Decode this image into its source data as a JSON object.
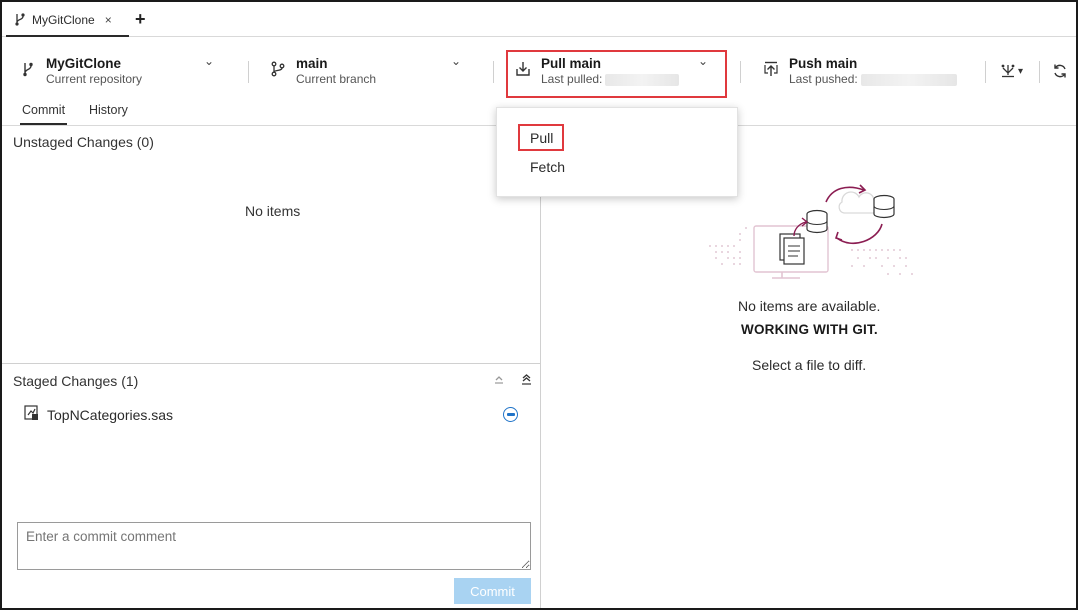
{
  "tab": {
    "title": "MyGitClone",
    "close": "×",
    "add": "+"
  },
  "toolbar": {
    "repo": {
      "title": "MyGitClone",
      "subtitle": "Current repository"
    },
    "branch": {
      "title": "main",
      "subtitle": "Current branch"
    },
    "pull": {
      "title": "Pull main",
      "subtitle": "Last pulled:"
    },
    "push": {
      "title": "Push main",
      "subtitle": "Last pushed:"
    },
    "chevron": "⌄",
    "more_caret": "▾"
  },
  "subtabs": [
    "Commit",
    "History"
  ],
  "unstaged": {
    "header": "Unstaged Changes (0)",
    "empty": "No items"
  },
  "staged": {
    "header": "Staged Changes (1)",
    "files": [
      "TopNCategories.sas"
    ]
  },
  "commit": {
    "placeholder": "Enter a commit comment",
    "button": "Commit"
  },
  "dropdown": {
    "items": [
      "Pull",
      "Fetch"
    ]
  },
  "empty_state": {
    "line1": "No items are available.",
    "line2": "WORKING WITH GIT.",
    "line3": "Select a file to diff."
  },
  "colors": {
    "accent": "#1f73c8",
    "highlight": "#e0393e",
    "illustration": "#8b1d52"
  }
}
